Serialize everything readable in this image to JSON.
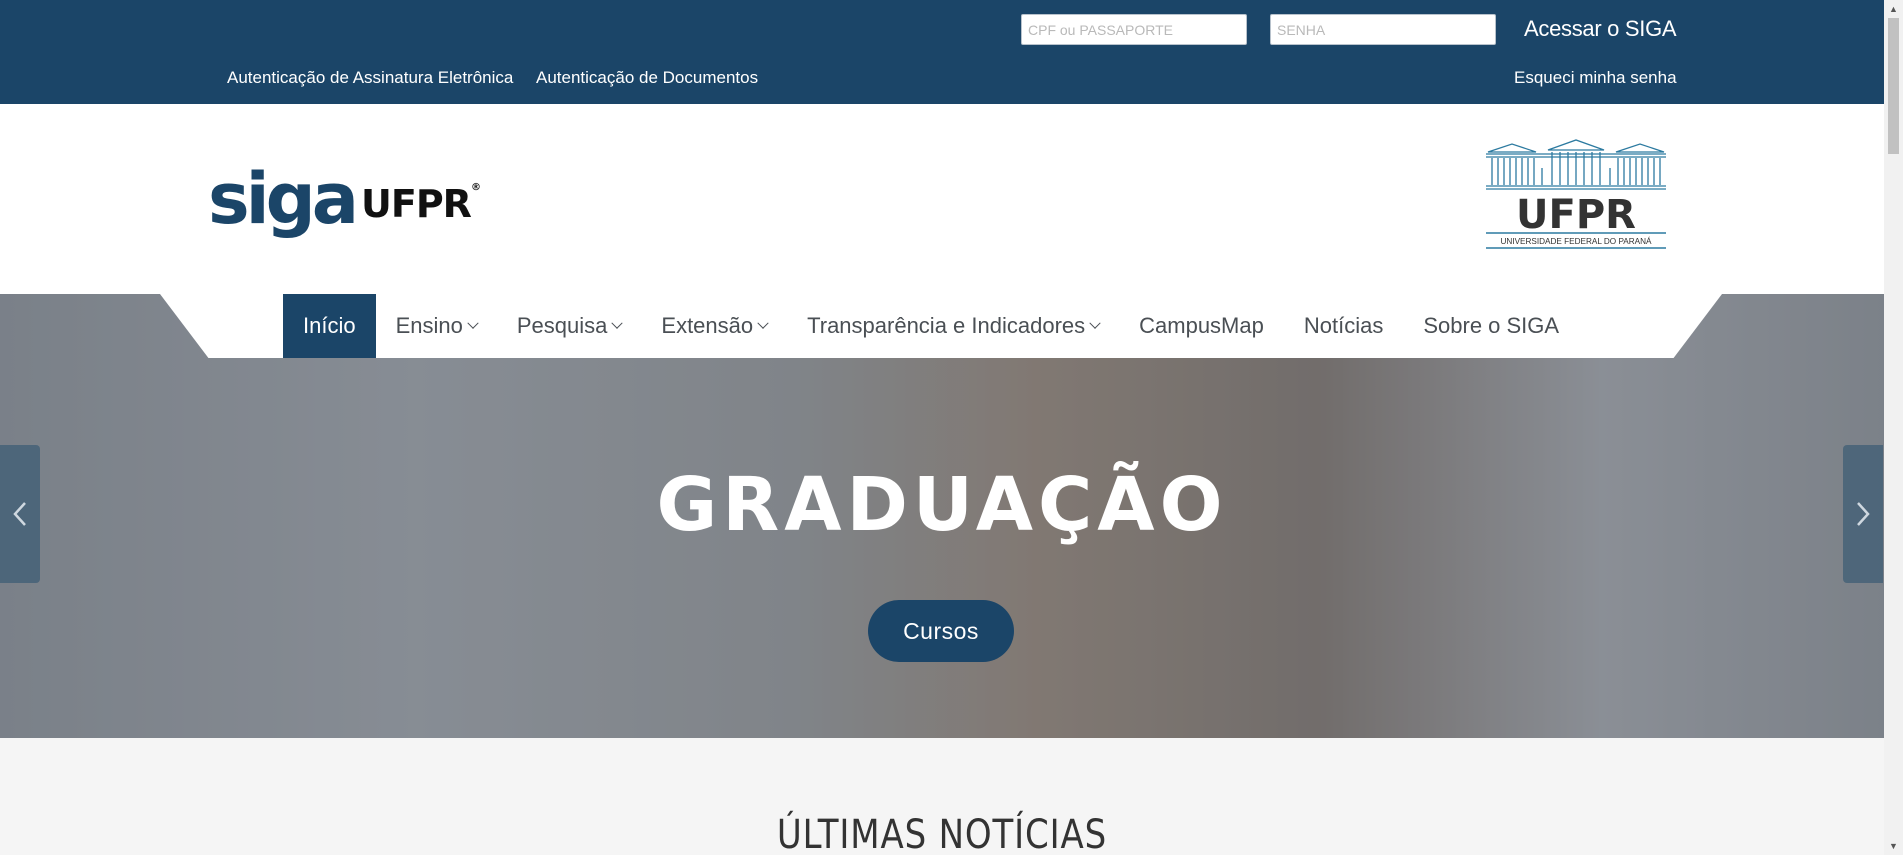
{
  "topbar": {
    "cpf_placeholder": "CPF ou PASSAPORTE",
    "senha_placeholder": "SENHA",
    "login_label": "Acessar o SIGA",
    "link_assinatura": "Autenticação de Assinatura Eletrônica",
    "link_documentos": "Autenticação de Documentos",
    "forgot_password": "Esqueci minha senha"
  },
  "header": {
    "logo_siga": "siga",
    "logo_ufpr": "UFPR",
    "ufpr_logo_text": "UFPR",
    "ufpr_logo_subtitle": "UNIVERSIDADE FEDERAL DO PARANÁ"
  },
  "nav": {
    "items": [
      {
        "label": "Início",
        "active": true
      },
      {
        "label": "Ensino",
        "dropdown": true
      },
      {
        "label": "Pesquisa",
        "dropdown": true
      },
      {
        "label": "Extensão",
        "dropdown": true
      },
      {
        "label": "Transparência e Indicadores",
        "dropdown": true
      },
      {
        "label": "CampusMap"
      },
      {
        "label": "Notícias"
      },
      {
        "label": "Sobre o SIGA"
      }
    ]
  },
  "hero": {
    "title": "GRADUAÇÃO",
    "button_label": "Cursos"
  },
  "news": {
    "title": "ÚLTIMAS NOTÍCIAS"
  },
  "colors": {
    "primary": "#1b4568",
    "accent": "#2c7aa0"
  },
  "icons": {
    "prev": "chevron-left-icon",
    "next": "chevron-right-icon",
    "dropdown": "chevron-down-icon"
  }
}
